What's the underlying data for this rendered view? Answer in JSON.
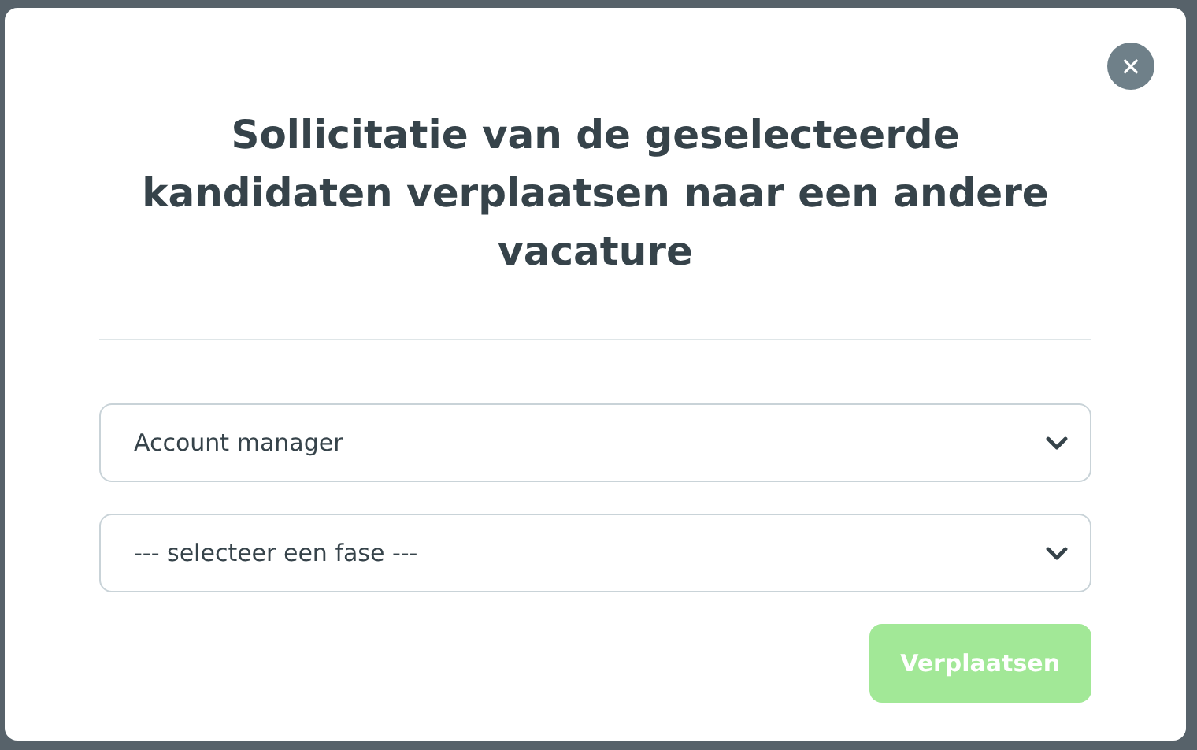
{
  "dialog": {
    "title": "Sollicitatie van de geselecteerde kandidaten verplaatsen naar een andere vacature",
    "close_button": {
      "label": "✕"
    },
    "selects": [
      {
        "value": "Account manager"
      },
      {
        "value": "--- selecteer een fase ---"
      }
    ],
    "submit_button": {
      "label": "Verplaatsen",
      "disabled": true
    }
  }
}
